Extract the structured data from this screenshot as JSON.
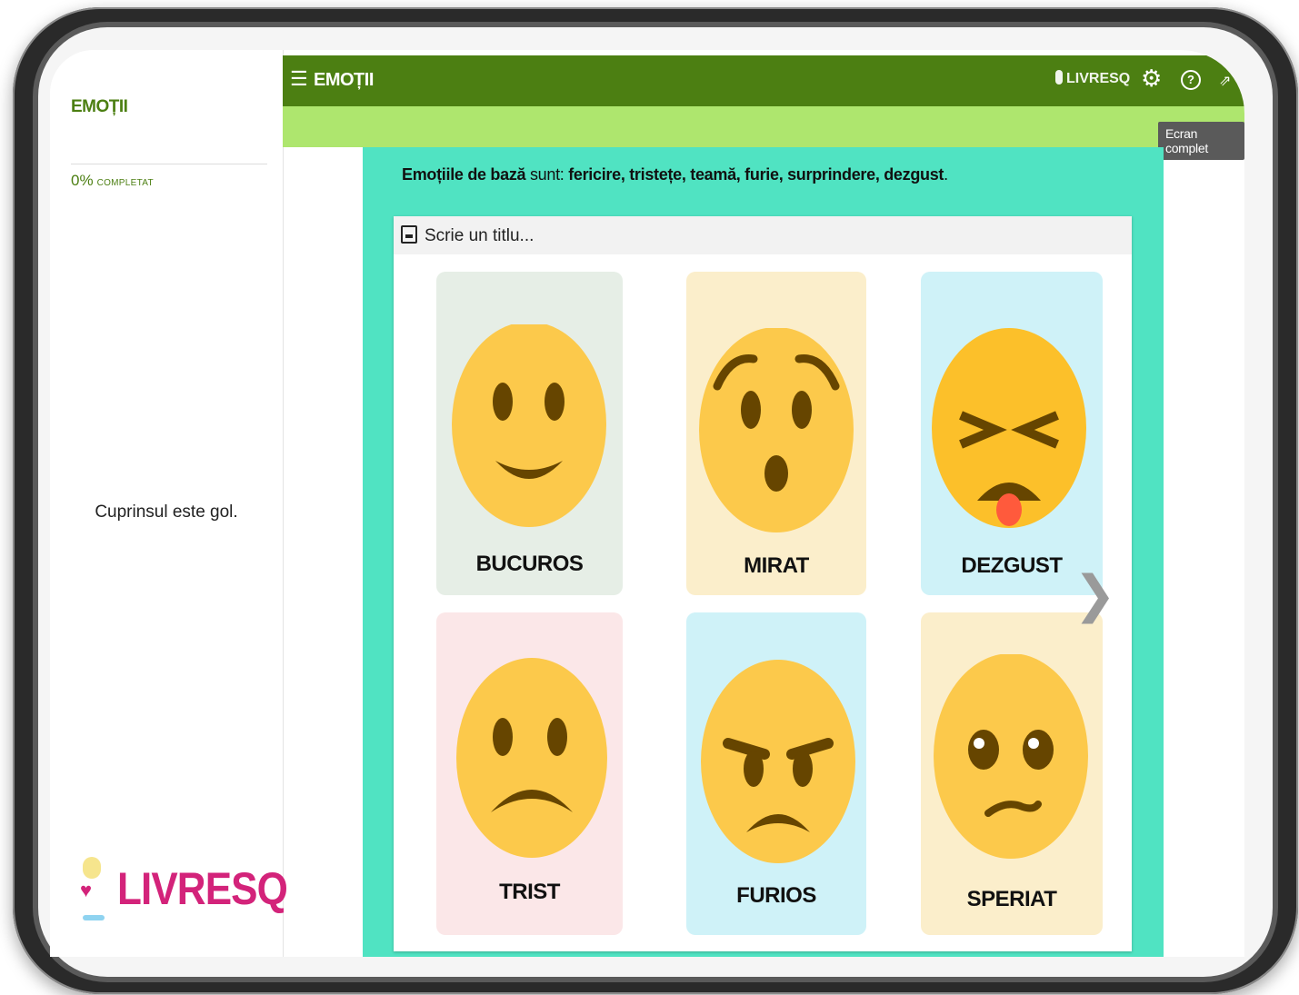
{
  "app": {
    "title": "EMOȚII",
    "brand": "LIVRESQ",
    "fullscreen_tooltip": "Ecran complet"
  },
  "sidebar": {
    "title": "EMOȚII",
    "progress_value": "0%",
    "progress_label": "COMPLETAT",
    "empty_text": "Cuprinsul este gol.",
    "logo_text": "LIVRESQ"
  },
  "content": {
    "intro_prefix": "Emoțiile de bază",
    "intro_middle": " sunt: ",
    "intro_list": "fericire, tristețe, teamă, furie, surprindere, dezgust",
    "intro_suffix": "."
  },
  "gallery": {
    "title_placeholder": "Scrie un titlu...",
    "cards": [
      {
        "label": "BUCUROS",
        "background": "#e6eee6",
        "expression": "happy"
      },
      {
        "label": "MIRAT",
        "background": "#fbeecb",
        "expression": "surprised"
      },
      {
        "label": "DEZGUST",
        "background": "#cff2f8",
        "expression": "disgusted"
      },
      {
        "label": "TRIST",
        "background": "#fbe7e8",
        "expression": "sad"
      },
      {
        "label": "FURIOS",
        "background": "#cff2f8",
        "expression": "angry"
      },
      {
        "label": "SPERIAT",
        "background": "#fbeecb",
        "expression": "scared"
      }
    ]
  },
  "colors": {
    "topbar": "#4c7f12",
    "subbar": "#aee66e",
    "content_band": "#50e3c2",
    "brand_pink": "#d3237a",
    "face": "#fcc94b",
    "feature": "#664500"
  },
  "icons": [
    "menu-icon",
    "livresq-pin-icon",
    "gear-icon",
    "help-icon",
    "fullscreen-icon",
    "gallery-image-icon",
    "chevron-right-icon"
  ]
}
